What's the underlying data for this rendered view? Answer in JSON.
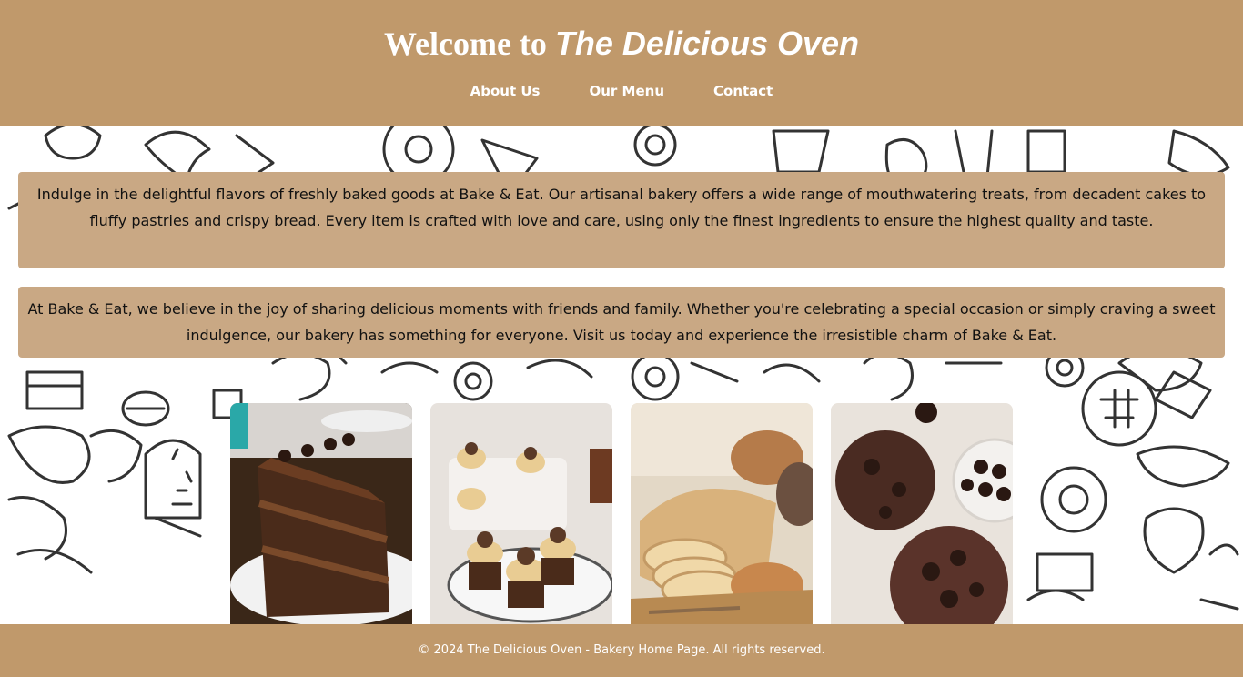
{
  "header": {
    "title_prefix": "Welcome to",
    "title_brand": "The Delicious Oven",
    "nav": [
      "About Us",
      "Our Menu",
      "Contact"
    ]
  },
  "intro": {
    "paragraph1": "Indulge in the delightful flavors of freshly baked goods at Bake & Eat. Our artisanal bakery offers a wide range of mouthwatering treats, from decadent cakes to fluffy pastries and crispy bread. Every item is crafted with love and care, using only the finest ingredients to ensure the highest quality and taste.",
    "paragraph2": "At Bake & Eat, we believe in the joy of sharing delicious moments with friends and family. Whether you're celebrating a special occasion or simply craving a sweet indulgence, our bakery has something for everyone. Visit us today and experience the irresistible charm of Bake & Eat."
  },
  "gallery": [
    "chocolate-cake-image",
    "cupcakes-image",
    "bread-basket-image",
    "chocolate-cookies-image"
  ],
  "footer": {
    "text": "© 2024 The Delicious Oven - Bakery Home Page. All rights reserved."
  },
  "colors": {
    "header_bg": "#c0996b",
    "panel_bg": "#c9a884",
    "text_light": "#ffffff"
  }
}
